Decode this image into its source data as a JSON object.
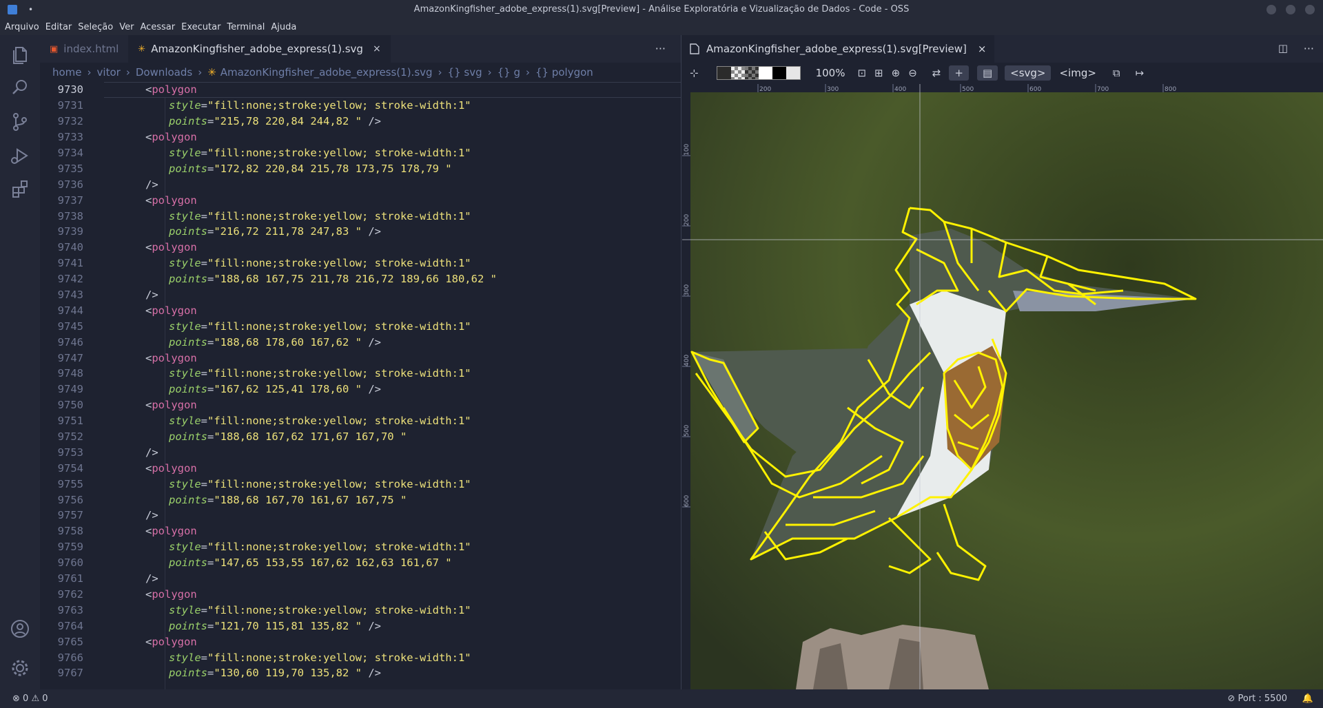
{
  "window": {
    "title": "AmazonKingfisher_adobe_express(1).svg[Preview] - Análise Exploratória e Vizualização de Dados - Code - OSS",
    "dot": "•"
  },
  "menu": [
    "Arquivo",
    "Editar",
    "Seleção",
    "Ver",
    "Acessar",
    "Executar",
    "Terminal",
    "Ajuda"
  ],
  "activity_icons": [
    "files-icon",
    "search-icon",
    "source-control-icon",
    "run-debug-icon",
    "extensions-icon",
    "account-icon",
    "settings-gear-icon"
  ],
  "editor": {
    "tabs": [
      {
        "label": "index.html",
        "icon": "html5-icon",
        "active": false
      },
      {
        "label": "AmazonKingfisher_adobe_express(1).svg",
        "icon": "svg-file-icon",
        "active": true,
        "close": "×"
      }
    ],
    "more": "···",
    "breadcrumb": [
      "home",
      "vitor",
      "Downloads",
      "AmazonKingfisher_adobe_express(1).svg",
      "{} svg",
      "{} g",
      "{} polygon"
    ],
    "lines": [
      {
        "n": "9730",
        "kind": "open"
      },
      {
        "n": "9731",
        "kind": "style",
        "val": "fill:none;stroke:yellow; stroke-width:1"
      },
      {
        "n": "9732",
        "kind": "points",
        "val": "215,78 220,84 244,82 ",
        "close": "/>"
      },
      {
        "n": "9733",
        "kind": "open"
      },
      {
        "n": "9734",
        "kind": "style",
        "val": "fill:none;stroke:yellow; stroke-width:1"
      },
      {
        "n": "9735",
        "kind": "points",
        "val": "172,82 220,84 215,78 173,75 178,79 ",
        "close": ""
      },
      {
        "n": "9736",
        "kind": "close"
      },
      {
        "n": "9737",
        "kind": "open"
      },
      {
        "n": "9738",
        "kind": "style",
        "val": "fill:none;stroke:yellow; stroke-width:1"
      },
      {
        "n": "9739",
        "kind": "points",
        "val": "216,72 211,78 247,83 ",
        "close": "/>"
      },
      {
        "n": "9740",
        "kind": "open"
      },
      {
        "n": "9741",
        "kind": "style",
        "val": "fill:none;stroke:yellow; stroke-width:1"
      },
      {
        "n": "9742",
        "kind": "points",
        "val": "188,68 167,75 211,78 216,72 189,66 180,62 ",
        "close": ""
      },
      {
        "n": "9743",
        "kind": "close"
      },
      {
        "n": "9744",
        "kind": "open"
      },
      {
        "n": "9745",
        "kind": "style",
        "val": "fill:none;stroke:yellow; stroke-width:1"
      },
      {
        "n": "9746",
        "kind": "points",
        "val": "188,68 178,60 167,62 ",
        "close": "/>"
      },
      {
        "n": "9747",
        "kind": "open"
      },
      {
        "n": "9748",
        "kind": "style",
        "val": "fill:none;stroke:yellow; stroke-width:1"
      },
      {
        "n": "9749",
        "kind": "points",
        "val": "167,62 125,41 178,60 ",
        "close": "/>"
      },
      {
        "n": "9750",
        "kind": "open"
      },
      {
        "n": "9751",
        "kind": "style",
        "val": "fill:none;stroke:yellow; stroke-width:1"
      },
      {
        "n": "9752",
        "kind": "points",
        "val": "188,68 167,62 171,67 167,70 ",
        "close": ""
      },
      {
        "n": "9753",
        "kind": "close"
      },
      {
        "n": "9754",
        "kind": "open"
      },
      {
        "n": "9755",
        "kind": "style",
        "val": "fill:none;stroke:yellow; stroke-width:1"
      },
      {
        "n": "9756",
        "kind": "points",
        "val": "188,68 167,70 161,67 167,75 ",
        "close": ""
      },
      {
        "n": "9757",
        "kind": "close"
      },
      {
        "n": "9758",
        "kind": "open"
      },
      {
        "n": "9759",
        "kind": "style",
        "val": "fill:none;stroke:yellow; stroke-width:1"
      },
      {
        "n": "9760",
        "kind": "points",
        "val": "147,65 153,55 167,62 162,63 161,67 ",
        "close": ""
      },
      {
        "n": "9761",
        "kind": "close"
      },
      {
        "n": "9762",
        "kind": "open"
      },
      {
        "n": "9763",
        "kind": "style",
        "val": "fill:none;stroke:yellow; stroke-width:1"
      },
      {
        "n": "9764",
        "kind": "points",
        "val": "121,70 115,81 135,82 ",
        "close": "/>"
      },
      {
        "n": "9765",
        "kind": "open"
      },
      {
        "n": "9766",
        "kind": "style",
        "val": "fill:none;stroke:yellow; stroke-width:1"
      },
      {
        "n": "9767",
        "kind": "points",
        "val": "130,60 119,70 135,82 ",
        "close": "/>"
      }
    ],
    "tokens": {
      "open_tag": "<polygon",
      "close_tag": "/>",
      "style_attr": "style",
      "points_attr": "points"
    }
  },
  "preview": {
    "tab_label": "AmazonKingfisher_adobe_express(1).svg[Preview]",
    "tab_close": "×",
    "zoom": "100%",
    "svg_toggle": "<svg>",
    "img_toggle": "<img>",
    "ruler_x": [
      "200",
      "300",
      "400",
      "500",
      "600",
      "700",
      "800"
    ],
    "ruler_y": [
      "100",
      "200",
      "300",
      "400",
      "500",
      "600"
    ],
    "colors": {
      "background": "#3c4a25",
      "stroke": "#fff200",
      "breast": "#9a6a33",
      "beak": "#8a93a3"
    }
  },
  "status": {
    "errors": "0",
    "warnings": "0",
    "port": "Port : 5500"
  }
}
